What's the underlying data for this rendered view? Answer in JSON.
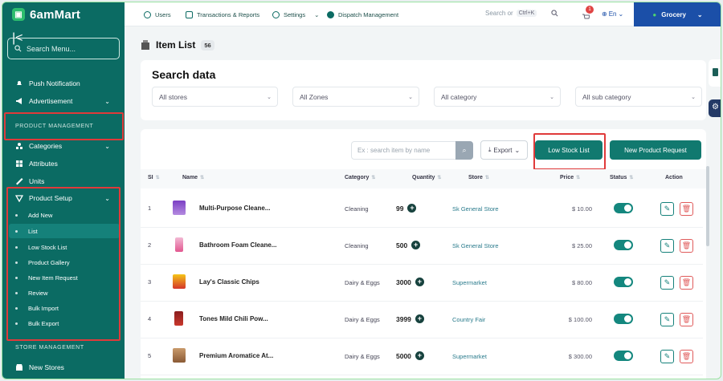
{
  "brand": {
    "name": "6amMart",
    "logo_icon": "store-logo-icon"
  },
  "sidebar": {
    "search_placeholder": "Search Menu...",
    "top_items": [
      {
        "label": "Push Notification",
        "icon": "bell-icon"
      },
      {
        "label": "Advertisement",
        "icon": "megaphone-icon"
      }
    ],
    "section_product": "PRODUCT MANAGEMENT",
    "product_items": [
      {
        "label": "Categories",
        "icon": "categories-icon"
      },
      {
        "label": "Attributes",
        "icon": "attributes-icon"
      },
      {
        "label": "Units",
        "icon": "ruler-icon"
      },
      {
        "label": "Product Setup",
        "icon": "tag-icon"
      }
    ],
    "sub_items": [
      "Add New",
      "List",
      "Low Stock List",
      "Product Gallery",
      "New Item Request",
      "Review",
      "Bulk Import",
      "Bulk Export"
    ],
    "section_store": "STORE MANAGEMENT",
    "store_items": [
      {
        "label": "New Stores",
        "icon": "store-icon"
      }
    ]
  },
  "topbar": {
    "nav": [
      "Users",
      "Transactions & Reports",
      "Settings",
      "Dispatch Management"
    ],
    "search_label": "Search or",
    "search_kbd": "Ctrl+K",
    "cart_badge": "1",
    "language": "En",
    "module": "Grocery"
  },
  "page": {
    "title": "Item List",
    "count": "56"
  },
  "filters": {
    "title": "Search data",
    "selects": [
      "All stores",
      "All Zones",
      "All category",
      "All sub category"
    ]
  },
  "toolbar": {
    "search_placeholder": "Ex : search item by name",
    "export_label": "Export",
    "low_stock_label": "Low Stock List",
    "new_request_label": "New Product Request"
  },
  "table": {
    "headers": [
      "SI",
      "Name",
      "Category",
      "Quantity",
      "Store",
      "Price",
      "Status",
      "Action"
    ],
    "rows": [
      {
        "si": "1",
        "name": "Multi-Purpose Cleane...",
        "category": "Cleaning",
        "quantity": "99",
        "store": "Sk General Store",
        "price": "$ 10.00"
      },
      {
        "si": "2",
        "name": "Bathroom Foam Cleane...",
        "category": "Cleaning",
        "quantity": "500",
        "store": "Sk General Store",
        "price": "$ 25.00"
      },
      {
        "si": "3",
        "name": "Lay's Classic Chips",
        "category": "Dairy & Eggs",
        "quantity": "3000",
        "store": "Supermarket",
        "price": "$ 80.00"
      },
      {
        "si": "4",
        "name": "Tones Mild Chili Pow...",
        "category": "Dairy & Eggs",
        "quantity": "3999",
        "store": "Country Fair",
        "price": "$ 100.00"
      },
      {
        "si": "5",
        "name": "Premium Aromatice At...",
        "category": "Dairy & Eggs",
        "quantity": "5000",
        "store": "Supermarket",
        "price": "$ 300.00"
      }
    ]
  },
  "colors": {
    "primary": "#0b6b63",
    "accent": "#11796f",
    "highlight": "#e03a3a",
    "module": "#1b4fa8"
  }
}
